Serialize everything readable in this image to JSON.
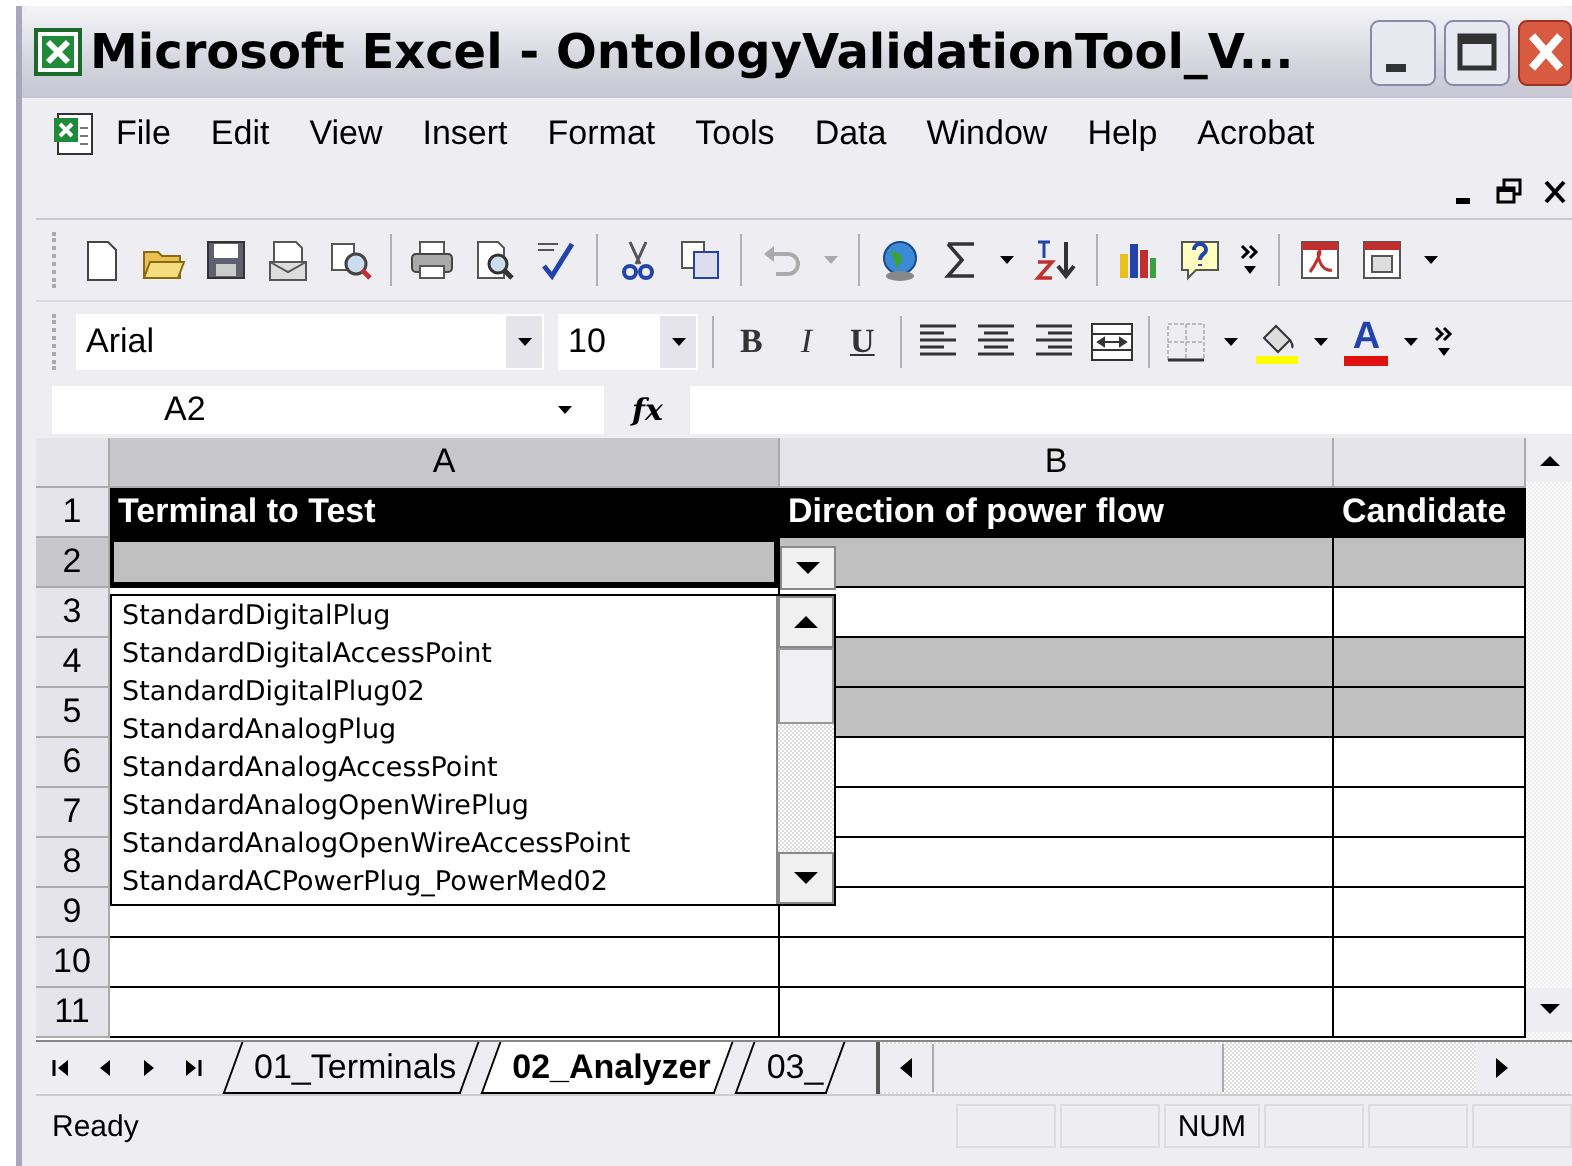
{
  "window": {
    "title": "Microsoft Excel - OntologyValidationTool_V..."
  },
  "menu": [
    "File",
    "Edit",
    "View",
    "Insert",
    "Format",
    "Tools",
    "Data",
    "Window",
    "Help",
    "Acrobat"
  ],
  "formatting": {
    "font": "Arial",
    "size": "10",
    "style_buttons": [
      "B",
      "I",
      "U"
    ],
    "font_color_glyph": "A"
  },
  "formula_bar": {
    "name_box": "A2",
    "function_label": "fx"
  },
  "columns": [
    {
      "label": "A",
      "selected": true
    },
    {
      "label": "B",
      "selected": false
    }
  ],
  "rows": [
    {
      "number": "1",
      "kind": "header",
      "cells": [
        "Terminal to Test",
        "Direction of power flow",
        "Candidate"
      ]
    },
    {
      "number": "2",
      "kind": "data",
      "shaded": true,
      "selected": true
    },
    {
      "number": "3",
      "kind": "data",
      "shaded": false,
      "selected": false
    },
    {
      "number": "4",
      "kind": "data",
      "shaded": true,
      "selected": false
    },
    {
      "number": "5",
      "kind": "data",
      "shaded": true,
      "selected": false
    },
    {
      "number": "6",
      "kind": "data",
      "shaded": false,
      "selected": false
    },
    {
      "number": "7",
      "kind": "data",
      "shaded": false,
      "selected": false
    },
    {
      "number": "8",
      "kind": "data",
      "shaded": false,
      "selected": false
    },
    {
      "number": "9",
      "kind": "data",
      "shaded": false,
      "selected": false
    },
    {
      "number": "10",
      "kind": "data",
      "shaded": false,
      "selected": false
    },
    {
      "number": "11",
      "kind": "data",
      "shaded": false,
      "selected": false
    }
  ],
  "dropdown": {
    "items": [
      "StandardDigitalPlug",
      "StandardDigitalAccessPoint",
      "StandardDigitalPlug02",
      "StandardAnalogPlug",
      "StandardAnalogAccessPoint",
      "StandardAnalogOpenWirePlug",
      "StandardAnalogOpenWireAccessPoint",
      "StandardACPowerPlug_PowerMed02"
    ]
  },
  "sheet_tabs": [
    {
      "label": "01_Terminals",
      "selected": false
    },
    {
      "label": "02_Analyzer",
      "selected": true
    },
    {
      "label": "03_",
      "selected": false
    }
  ],
  "status_bar": {
    "message": "Ready",
    "indicators": [
      "NUM"
    ]
  }
}
